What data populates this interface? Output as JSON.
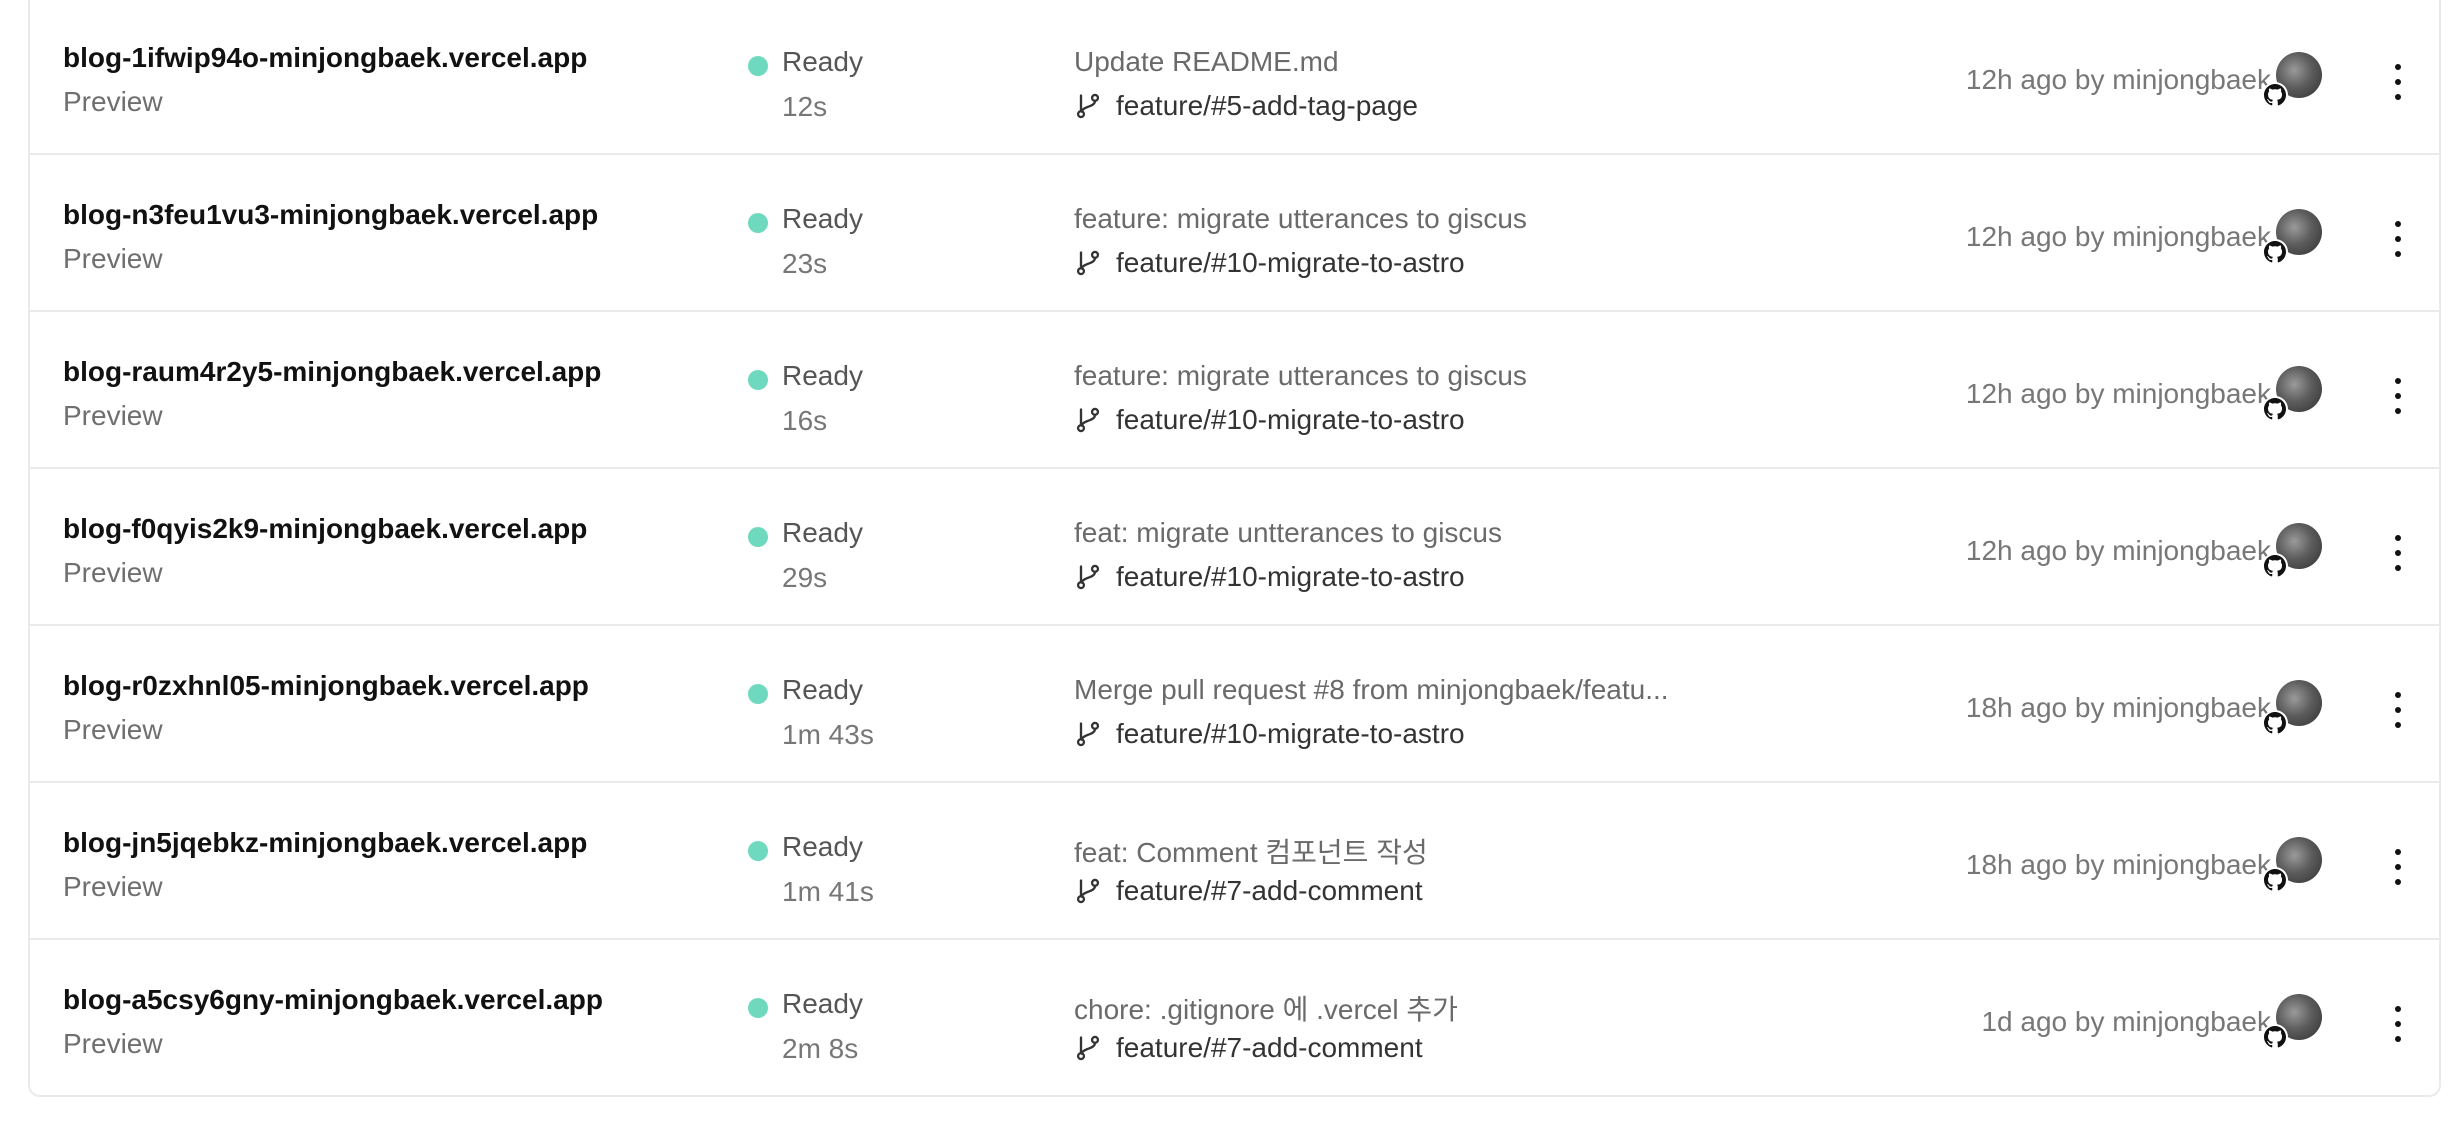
{
  "deployments": [
    {
      "url": "blog-1ifwip94o-minjongbaek.vercel.app",
      "environment": "Preview",
      "status": "Ready",
      "duration": "12s",
      "commit_message": "Update README.md",
      "branch": "feature/#5-add-tag-page",
      "time_author": "12h ago by minjongbaek"
    },
    {
      "url": "blog-n3feu1vu3-minjongbaek.vercel.app",
      "environment": "Preview",
      "status": "Ready",
      "duration": "23s",
      "commit_message": "feature: migrate utterances to giscus",
      "branch": "feature/#10-migrate-to-astro",
      "time_author": "12h ago by minjongbaek"
    },
    {
      "url": "blog-raum4r2y5-minjongbaek.vercel.app",
      "environment": "Preview",
      "status": "Ready",
      "duration": "16s",
      "commit_message": "feature: migrate utterances to giscus",
      "branch": "feature/#10-migrate-to-astro",
      "time_author": "12h ago by minjongbaek"
    },
    {
      "url": "blog-f0qyis2k9-minjongbaek.vercel.app",
      "environment": "Preview",
      "status": "Ready",
      "duration": "29s",
      "commit_message": "feat: migrate untterances to giscus",
      "branch": "feature/#10-migrate-to-astro",
      "time_author": "12h ago by minjongbaek"
    },
    {
      "url": "blog-r0zxhnl05-minjongbaek.vercel.app",
      "environment": "Preview",
      "status": "Ready",
      "duration": "1m 43s",
      "commit_message": "Merge pull request #8 from minjongbaek/featu...",
      "branch": "feature/#10-migrate-to-astro",
      "time_author": "18h ago by minjongbaek"
    },
    {
      "url": "blog-jn5jqebkz-minjongbaek.vercel.app",
      "environment": "Preview",
      "status": "Ready",
      "duration": "1m 41s",
      "commit_message": "feat: Comment 컴포넌트 작성",
      "branch": "feature/#7-add-comment",
      "time_author": "18h ago by minjongbaek"
    },
    {
      "url": "blog-a5csy6gny-minjongbaek.vercel.app",
      "environment": "Preview",
      "status": "Ready",
      "duration": "2m 8s",
      "commit_message": "chore: .gitignore 에 .vercel 추가",
      "branch": "feature/#7-add-comment",
      "time_author": "1d ago by minjongbaek"
    }
  ],
  "colors": {
    "status_ready": "#6fd9c0",
    "border": "#eaeaea"
  },
  "icons": {
    "branch": "git-branch-icon",
    "provider": "github-icon",
    "menu": "more-vertical-icon"
  }
}
